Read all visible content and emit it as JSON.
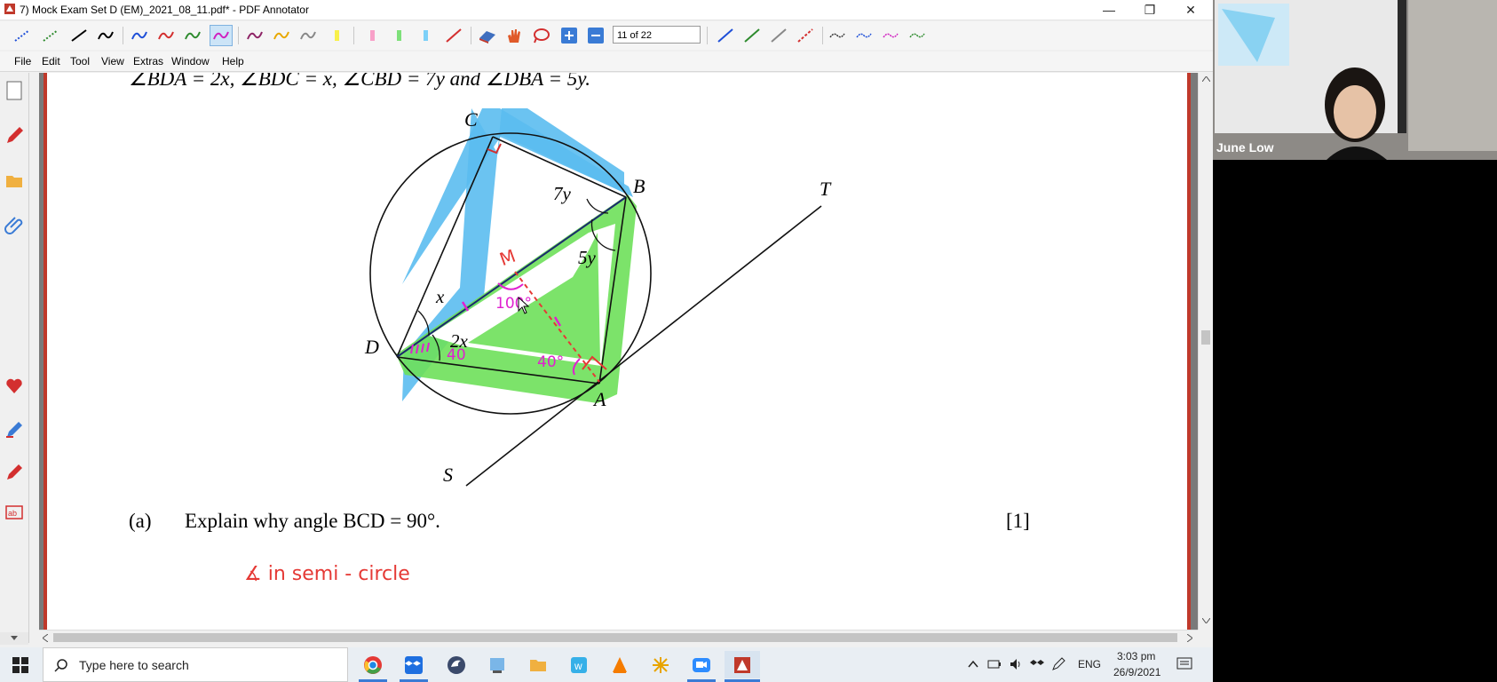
{
  "window": {
    "title": "7) Mock Exam Set D (EM)_2021_08_11.pdf* - PDF Annotator"
  },
  "toolbar": {
    "page_indicator": "11 of 22"
  },
  "menu": [
    "File",
    "Edit",
    "Tool",
    "View",
    "Extras",
    "Window",
    "Help"
  ],
  "document": {
    "given_line": "∠BDA = 2x, ∠BDC = x, ∠CBD = 7y and ∠DBA = 5y.",
    "question_label": "(a)",
    "question_text": "Explain why angle BCD = 90°.",
    "marks": "[1]",
    "handwritten_answer": "∡ in semi - circle",
    "diagram_labels": {
      "C": "C",
      "B": "B",
      "D": "D",
      "A": "A",
      "T": "T",
      "S": "S",
      "angle_7y": "7y",
      "angle_5y": "5y",
      "angle_x": "x",
      "angle_2x": "2x"
    },
    "annotations": {
      "m": "M",
      "deg100": "100°",
      "deg40a": "40",
      "deg40b": "40°"
    }
  },
  "taskbar": {
    "search_placeholder": "Type here to search",
    "lang": "ENG",
    "time": "3:03 pm",
    "date": "26/9/2021"
  },
  "video": {
    "participant": "June Low"
  },
  "colors": {
    "accent_red": "#c0392b",
    "highlight_blue": "#5bbcf0",
    "highlight_green": "#6ee05a",
    "pen_magenta": "#e020d0",
    "pen_red": "#e53935"
  }
}
